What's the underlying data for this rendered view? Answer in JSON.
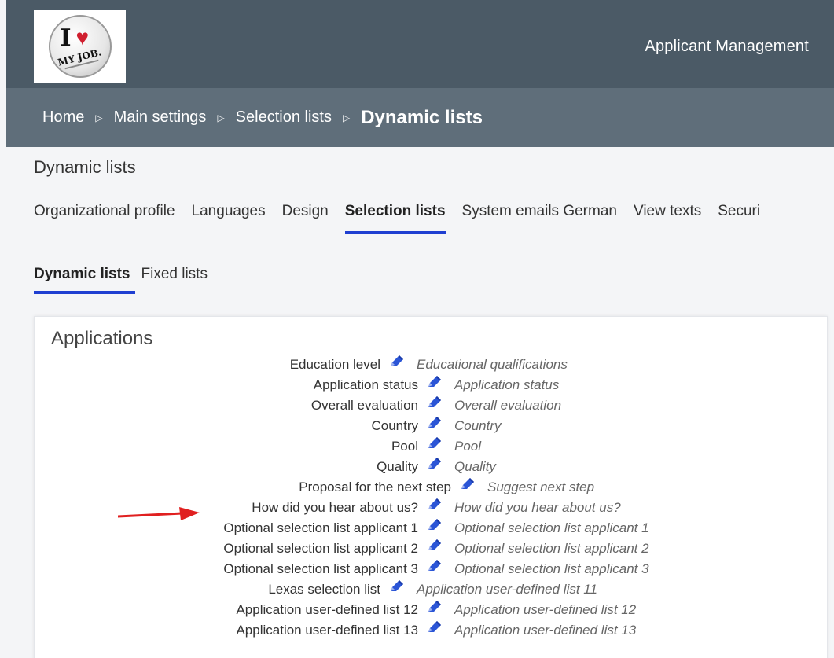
{
  "header": {
    "logo_text": "I ♥ MY JOB.",
    "app_title": "Applicant Management"
  },
  "breadcrumb": {
    "items": [
      "Home",
      "Main settings",
      "Selection lists",
      "Dynamic lists"
    ],
    "separator": "▷"
  },
  "page": {
    "title": "Dynamic lists"
  },
  "tabs": [
    {
      "label": "Organizational profile",
      "active": false
    },
    {
      "label": "Languages",
      "active": false
    },
    {
      "label": "Design",
      "active": false
    },
    {
      "label": "Selection lists",
      "active": true
    },
    {
      "label": "System emails German",
      "active": false
    },
    {
      "label": "View texts",
      "active": false
    },
    {
      "label": "Securi",
      "active": false
    }
  ],
  "subtabs": [
    {
      "label": "Dynamic lists",
      "active": true
    },
    {
      "label": "Fixed lists",
      "active": false
    }
  ],
  "card": {
    "title": "Applications",
    "rows": [
      {
        "label": "Education level",
        "desc": "Educational qualifications"
      },
      {
        "label": "Application status",
        "desc": "Application status"
      },
      {
        "label": "Overall evaluation",
        "desc": "Overall evaluation"
      },
      {
        "label": "Country",
        "desc": "Country"
      },
      {
        "label": "Pool",
        "desc": "Pool"
      },
      {
        "label": "Quality",
        "desc": "Quality"
      },
      {
        "label": "Proposal for the next step",
        "desc": "Suggest next step"
      },
      {
        "label": "How did you hear about us?",
        "desc": "How did you hear about us?"
      },
      {
        "label": "Optional selection list applicant 1",
        "desc": "Optional selection list applicant 1"
      },
      {
        "label": "Optional selection list applicant 2",
        "desc": "Optional selection list applicant 2"
      },
      {
        "label": "Optional selection list applicant 3",
        "desc": "Optional selection list applicant 3"
      },
      {
        "label": "Lexas selection list",
        "desc": "Application user-defined list 11"
      },
      {
        "label": "Application user-defined list 12",
        "desc": "Application user-defined list 12"
      },
      {
        "label": "Application user-defined list 13",
        "desc": "Application user-defined list 13"
      }
    ]
  },
  "colors": {
    "header_bg": "#4b5a66",
    "breadcrumb_bg": "#5f6e7a",
    "accent_blue": "#1f3fd1",
    "pencil_blue": "#2b55d6",
    "annotation_red": "#e02020"
  }
}
